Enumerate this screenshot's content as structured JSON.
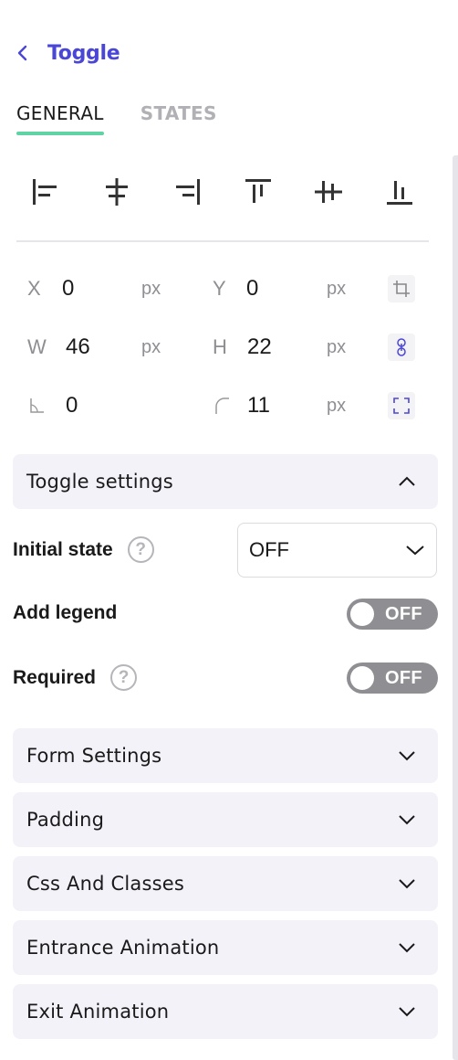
{
  "header": {
    "title": "Toggle",
    "back_icon": "chevron-left-icon"
  },
  "tabs": [
    {
      "label": "GENERAL",
      "active": true
    },
    {
      "label": "STATES",
      "active": false
    }
  ],
  "alignment": {
    "icons": [
      "align-left-icon",
      "align-center-horizontal-icon",
      "align-right-icon",
      "align-top-icon",
      "align-middle-vertical-icon",
      "align-bottom-icon"
    ]
  },
  "geometry": {
    "x": {
      "label": "X",
      "value": "0",
      "unit": "px"
    },
    "y": {
      "label": "Y",
      "value": "0",
      "unit": "px"
    },
    "w": {
      "label": "W",
      "value": "46",
      "unit": "px"
    },
    "h": {
      "label": "H",
      "value": "22",
      "unit": "px"
    },
    "rotation": {
      "value": "0"
    },
    "radius": {
      "value": "11",
      "unit": "px"
    }
  },
  "toggle_settings": {
    "title": "Toggle settings",
    "initial_state": {
      "label": "Initial state",
      "value": "OFF",
      "help": "?"
    },
    "add_legend": {
      "label": "Add legend",
      "state": "OFF"
    },
    "required": {
      "label": "Required",
      "state": "OFF",
      "help": "?"
    }
  },
  "sections": [
    {
      "title": "Form Settings"
    },
    {
      "title": "Padding"
    },
    {
      "title": "Css And Classes"
    },
    {
      "title": "Entrance Animation"
    },
    {
      "title": "Exit Animation"
    }
  ],
  "colors": {
    "accent": "#4b47d6",
    "tab_underline": "#5fd3a3",
    "toggle_off": "#8e8e93",
    "section_bg": "#f2f2f8"
  }
}
